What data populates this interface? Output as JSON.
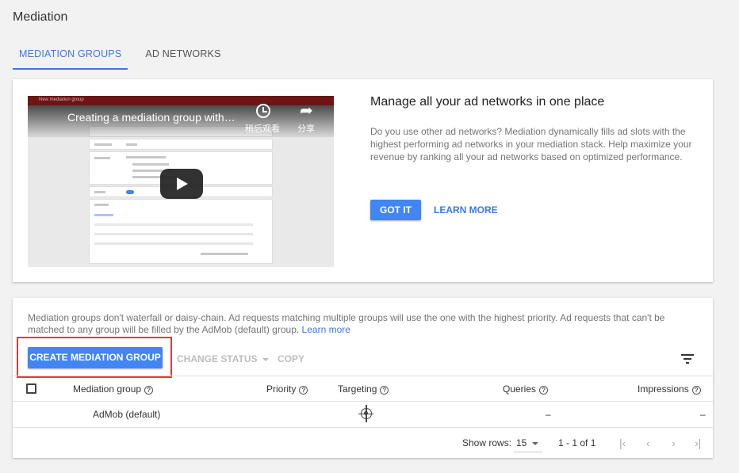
{
  "page": {
    "title": "Mediation"
  },
  "tabs": [
    {
      "label": "MEDIATION GROUPS",
      "active": true
    },
    {
      "label": "AD NETWORKS",
      "active": false
    }
  ],
  "promo": {
    "video": {
      "title": "Creating a mediation group with…",
      "watch_later": "稍后观看",
      "share": "分享",
      "browser_bar_text": "New mediation group"
    },
    "heading": "Manage all your ad networks in one place",
    "body": "Do you use other ad networks? Mediation dynamically fills ad slots with the highest performing ad networks in your mediation stack. Help maximize your revenue by ranking all your ad networks based on optimized performance.",
    "got_it": "GOT IT",
    "learn_more": "LEARN MORE"
  },
  "groups": {
    "info": "Mediation groups don't waterfall or daisy-chain. Ad requests matching multiple groups will use the one with the highest priority. Ad requests that can't be matched to any group will be filled by the AdMob (default) group.",
    "info_link": "Learn more",
    "toolbar": {
      "create": "CREATE MEDIATION GROUP",
      "change_status": "CHANGE STATUS",
      "copy": "COPY"
    },
    "columns": {
      "name": "Mediation group",
      "priority": "Priority",
      "targeting": "Targeting",
      "queries": "Queries",
      "impressions": "Impressions"
    },
    "rows": [
      {
        "name": "AdMob (default)",
        "priority": "",
        "queries": "–",
        "impressions": "–"
      }
    ],
    "footer": {
      "show_rows_label": "Show rows:",
      "rows_per_page": "15",
      "range": "1 - 1 of 1"
    }
  },
  "colors": {
    "accent": "#3b78e7",
    "primary_button": "#4285f4",
    "highlight_box": "#e53935",
    "background": "#f2f2f2"
  }
}
